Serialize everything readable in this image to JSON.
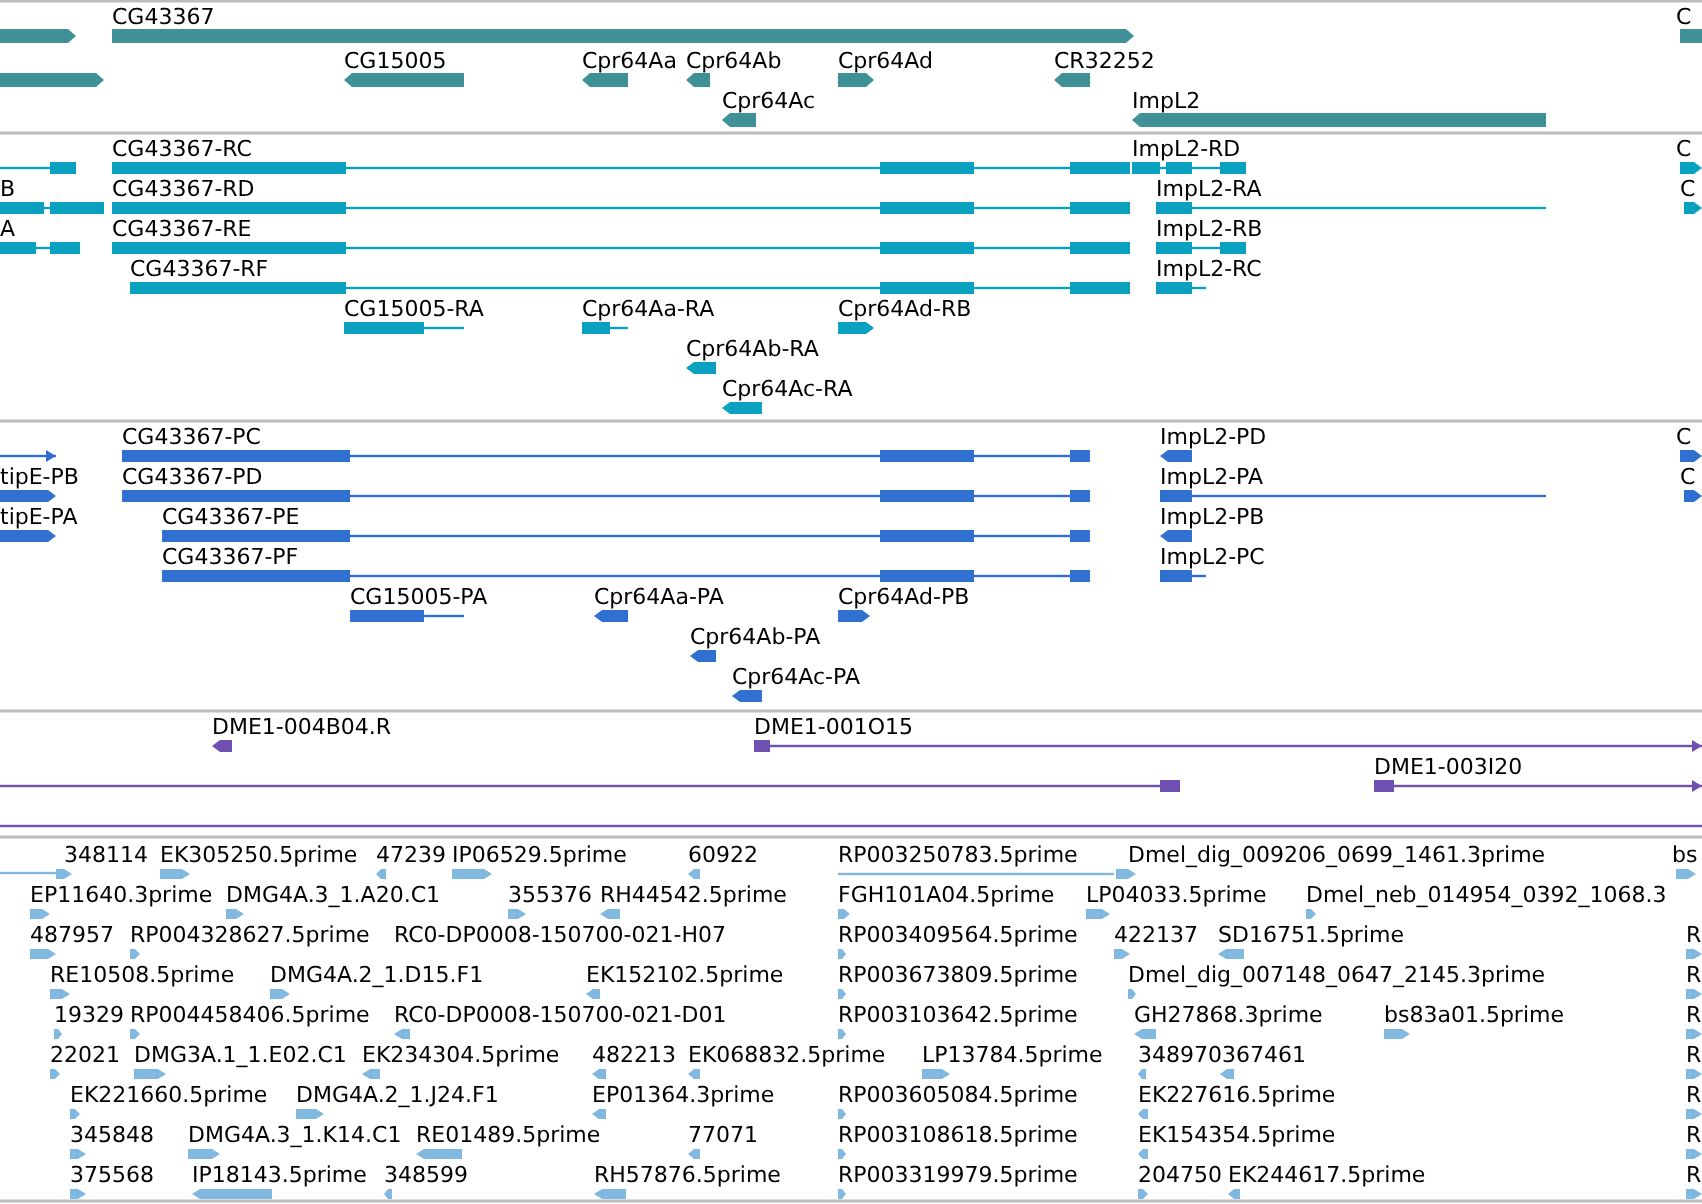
{
  "tracks": [
    {
      "kind": "gene",
      "color": "#3f9197",
      "features": [
        "CG43367",
        "C",
        "CG15005",
        "Cpr64Aa",
        "Cpr64Ab",
        "Cpr64Ad",
        "CR32252",
        "Cpr64Ac",
        "ImpL2"
      ]
    },
    {
      "kind": "transcript",
      "color": "#0aa0c0",
      "features": [
        "CG43367-RC",
        "ImpL2-RD",
        "C",
        "B",
        "CG43367-RD",
        "ImpL2-RA",
        "C",
        "A",
        "CG43367-RE",
        "ImpL2-RB",
        "CG43367-RF",
        "ImpL2-RC",
        "CG15005-RA",
        "Cpr64Aa-RA",
        "Cpr64Ad-RB",
        "Cpr64Ab-RA",
        "Cpr64Ac-RA"
      ]
    },
    {
      "kind": "protein",
      "color": "#3070d0",
      "features": [
        "CG43367-PC",
        "ImpL2-PD",
        "C",
        "tipE-PB",
        "CG43367-PD",
        "ImpL2-PA",
        "C",
        "tipE-PA",
        "CG43367-PE",
        "ImpL2-PB",
        "CG43367-PF",
        "ImpL2-PC",
        "CG15005-PA",
        "Cpr64Aa-PA",
        "Cpr64Ad-PB",
        "Cpr64Ab-PA",
        "Cpr64Ac-PA"
      ]
    },
    {
      "kind": "clone",
      "color": "#7050b0",
      "features": [
        "DME1-004B04.R",
        "DME1-001O15",
        "DME1-003I20"
      ]
    },
    {
      "kind": "est",
      "color": "#80b8e0",
      "rows": [
        [
          "348114",
          "EK305250.5prime",
          "47239",
          "IP06529.5prime",
          "60922",
          "RP003250783.5prime",
          "Dmel_dig_009206_0699_1461.3prime",
          "bs"
        ],
        [
          "EP11640.3prime",
          "DMG4A.3_1.A20.C1",
          "355376",
          "RH44542.5prime",
          "FGH101A04.5prime",
          "LP04033.5prime",
          "Dmel_neb_014954_0392_1068.3"
        ],
        [
          "487957",
          "RP004328627.5prime",
          "RC0-DP0008-150700-021-H07",
          "RP003409564.5prime",
          "422137",
          "SD16751.5prime",
          "R"
        ],
        [
          "RE10508.5prime",
          "DMG4A.2_1.D15.F1",
          "EK152102.5prime",
          "RP003673809.5prime",
          "Dmel_dig_007148_0647_2145.3prime",
          "R"
        ],
        [
          "19329",
          "RP004458406.5prime",
          "RC0-DP0008-150700-021-D01",
          "RP003103642.5prime",
          "GH27868.3prime",
          "bs83a01.5prime",
          "R"
        ],
        [
          "22021",
          "DMG3A.1_1.E02.C1",
          "EK234304.5prime",
          "482213",
          "EK068832.5prime",
          "LP13784.5prime",
          "348970",
          "367461",
          "R"
        ],
        [
          "EK221660.5prime",
          "DMG4A.2_1.J24.F1",
          "EP01364.3prime",
          "RP003605084.5prime",
          "EK227616.5prime",
          "R"
        ],
        [
          "345848",
          "DMG4A.3_1.K14.C1",
          "RE01489.5prime",
          "77071",
          "RP003108618.5prime",
          "EK154354.5prime",
          "R"
        ],
        [
          "375568",
          "IP18143.5prime",
          "348599",
          "RH57876.5prime",
          "RP003319979.5prime",
          "204750",
          "EK244617.5prime",
          "R"
        ]
      ]
    }
  ]
}
